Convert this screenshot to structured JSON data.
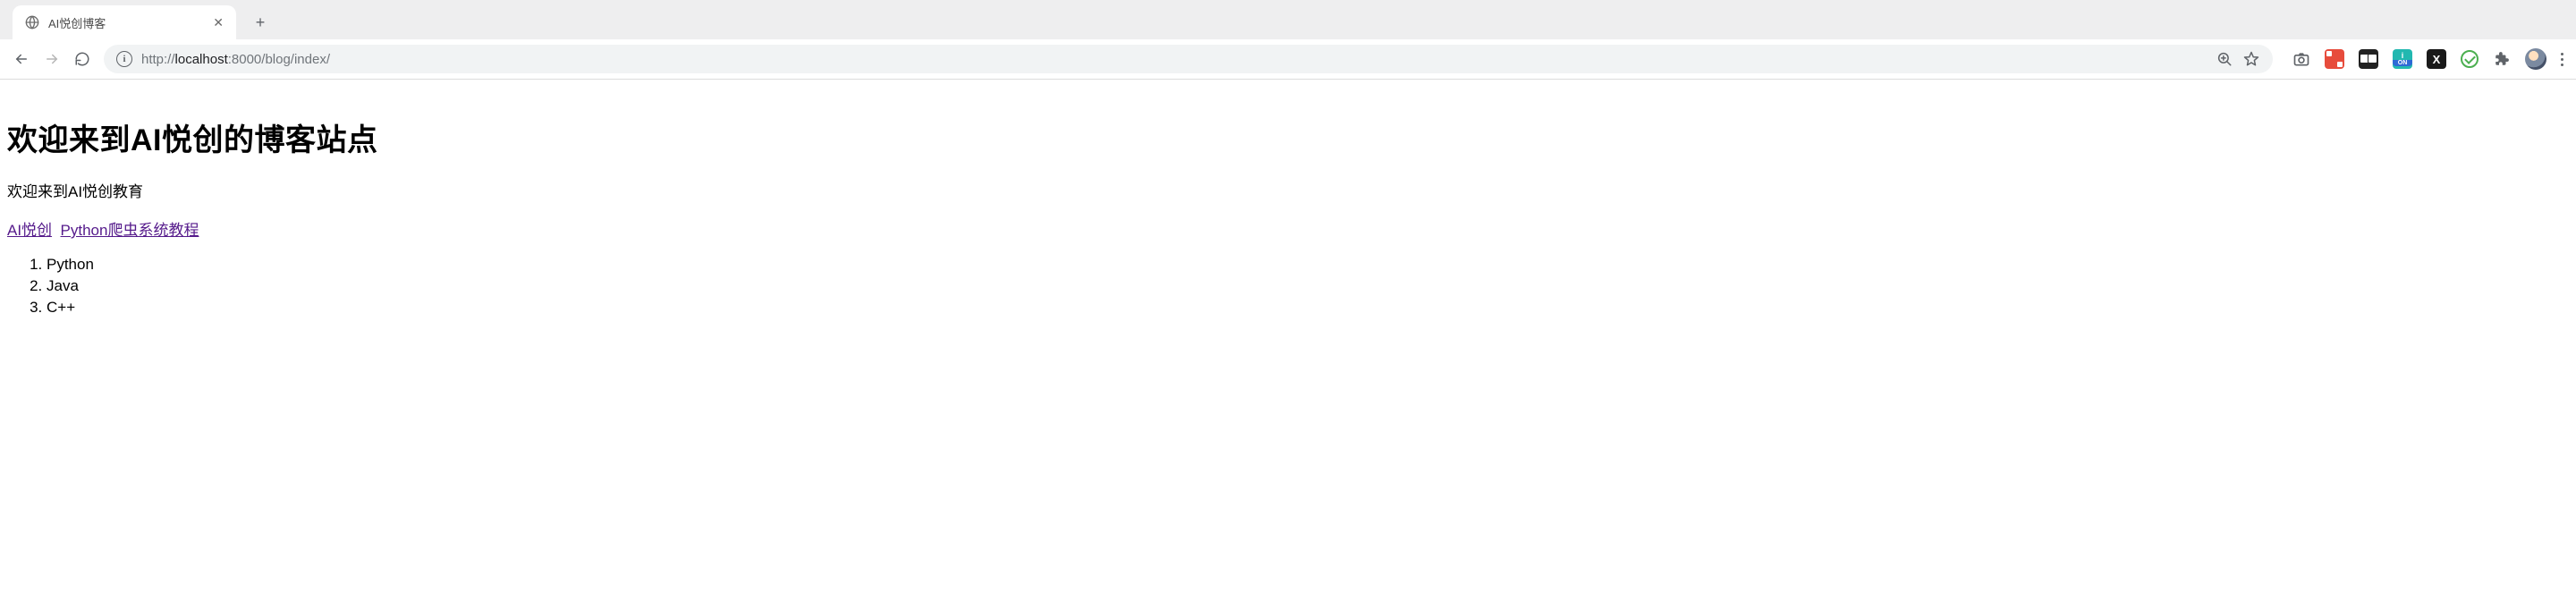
{
  "browser": {
    "tab_title": "AI悦创博客",
    "url": {
      "protocol": "http://",
      "host": "localhost",
      "port_path": ":8000/blog/index/"
    }
  },
  "page": {
    "heading": "欢迎来到AI悦创的博客站点",
    "intro": "欢迎来到AI悦创教育",
    "links": [
      {
        "text": "AI悦创"
      },
      {
        "text": "Python爬虫系统教程"
      }
    ],
    "list_items": [
      "Python",
      "Java",
      "C++"
    ]
  },
  "extensions": {
    "teal_top": "i",
    "teal_sub": "ON",
    "x_label": "X"
  }
}
